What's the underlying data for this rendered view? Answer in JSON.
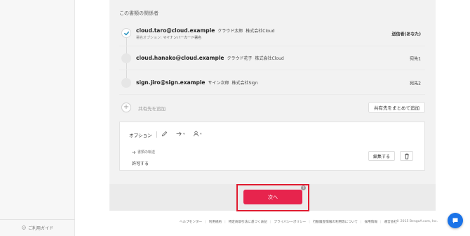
{
  "sidebar": {
    "guide_label": "ご利用ガイド"
  },
  "participants": {
    "title": "この書類の関係者",
    "people": [
      {
        "email": "cloud.taro@cloud.example",
        "name": "クラウド太郎",
        "company": "株式会社Cloud",
        "option_prefix": "署名オプション:",
        "option_value": "マイナンバーカード署名",
        "role": "送信者(あなた)",
        "done": true
      },
      {
        "email": "cloud.hanako@cloud.example",
        "name": "クラウド花子",
        "company": "株式会社Cloud",
        "role": "宛先1",
        "done": false
      },
      {
        "email": "sign.jiro@sign.example",
        "name": "サイン次郎",
        "company": "株式会社Sign",
        "role": "宛先2",
        "done": false
      }
    ],
    "add_label": "共有先を追加",
    "bulk_add_label": "共有先をまとめて追加"
  },
  "options": {
    "label": "オプション",
    "transfer_title": "書類の転送",
    "transfer_value": "許可する",
    "edit_label": "編集する"
  },
  "next_button": {
    "label": "次へ",
    "help": "?"
  },
  "footer": {
    "links": [
      "ヘルプセンター",
      "利用規約",
      "特定商取引法に基づく表記",
      "プライバシーポリシー",
      "行動履歴情報の利用等について",
      "採用情報",
      "運営会社"
    ],
    "copyright": "© 2015 BengoA.com, Inc."
  },
  "colors": {
    "accent": "#e7244d",
    "highlight": "#e01b2f",
    "check": "#1f8fbd",
    "chat": "#1a73e8"
  }
}
